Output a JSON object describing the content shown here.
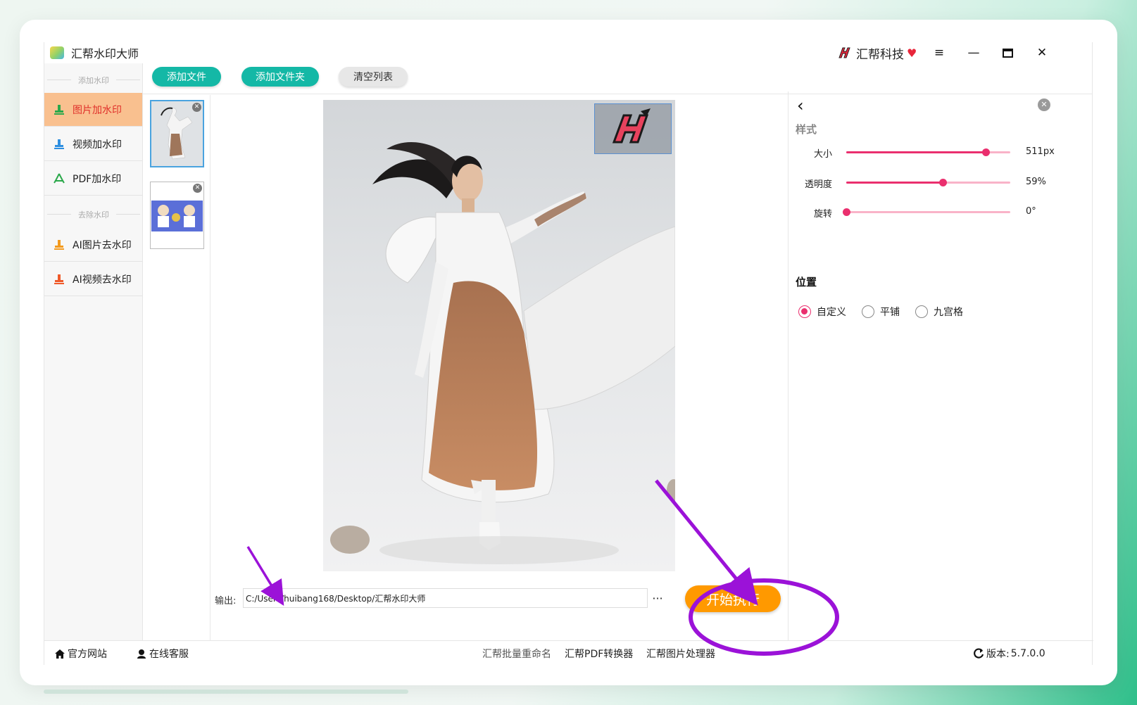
{
  "app": {
    "title": "汇帮水印大师"
  },
  "brand": {
    "name": "汇帮科技"
  },
  "window": {
    "menu_icon": "menu-icon",
    "minimize_icon": "minimize-icon",
    "maximize_icon": "maximize-icon",
    "close_icon": "close-icon"
  },
  "toolbar": {
    "add_file": "添加文件",
    "add_folder": "添加文件夹",
    "clear_list": "清空列表"
  },
  "sidebar": {
    "section_add": "添加水印",
    "section_remove": "去除水印",
    "items": [
      {
        "label": "图片加水印",
        "icon": "image-stamp-icon",
        "active": true
      },
      {
        "label": "视频加水印",
        "icon": "video-stamp-icon",
        "active": false
      },
      {
        "label": "PDF加水印",
        "icon": "pdf-icon",
        "active": false
      },
      {
        "label": "AI图片去水印",
        "icon": "ai-image-icon",
        "active": false
      },
      {
        "label": "AI视频去水印",
        "icon": "ai-video-icon",
        "active": false
      }
    ]
  },
  "output": {
    "label": "输出:",
    "path": "C:/Users/huibang168/Desktop/汇帮水印大师",
    "more": "···"
  },
  "actions": {
    "start": "开始执行"
  },
  "panel": {
    "style_title": "样式",
    "size": {
      "label": "大小",
      "value": "511px",
      "level": 0.85
    },
    "opacity": {
      "label": "透明度",
      "value": "59%",
      "level": 0.59
    },
    "rotate": {
      "label": "旋转",
      "value": "0°",
      "level": 0.0
    },
    "position_title": "位置",
    "position_options": [
      "自定义",
      "平铺",
      "九宫格"
    ],
    "position_selected": "自定义"
  },
  "status": {
    "website": "官方网站",
    "support": "在线客服",
    "links": [
      "汇帮批量重命名",
      "汇帮PDF转换器",
      "汇帮图片处理器"
    ],
    "version_label": "版本:",
    "version": "5.7.0.0"
  },
  "colors": {
    "accent_teal": "#14b8a6",
    "accent_orange": "#ff9900",
    "slider_pink": "#ea2f6e",
    "annotation_purple": "#9b12d8",
    "active_item_bg": "#f9c08f"
  }
}
